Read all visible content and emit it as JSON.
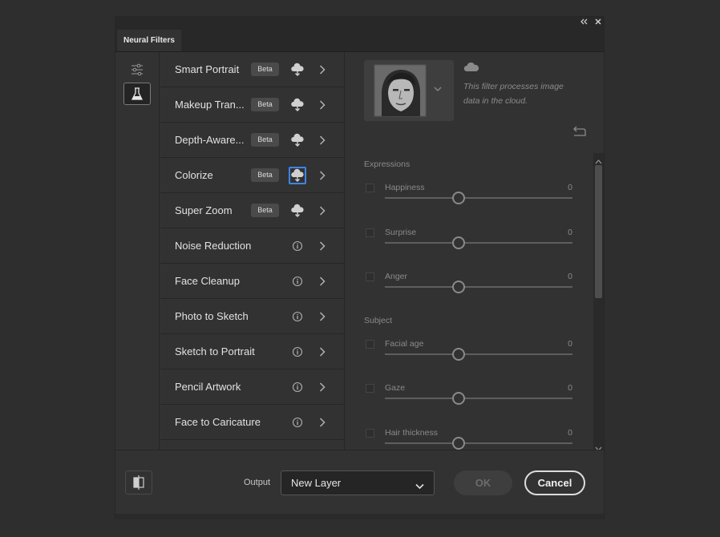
{
  "panel": {
    "tab_label": "Neural Filters",
    "collapse_icon": "double-chevron-left-icon",
    "close_icon": "close-icon"
  },
  "left_rail": {
    "items": [
      {
        "icon": "sliders-icon",
        "active": false
      },
      {
        "icon": "beaker-icon",
        "active": true
      }
    ]
  },
  "filters": [
    {
      "label": "Smart Portrait",
      "badge": "Beta",
      "icon": "cloud-download-icon"
    },
    {
      "label": "Makeup Tran...",
      "badge": "Beta",
      "icon": "cloud-download-icon"
    },
    {
      "label": "Depth-Aware...",
      "badge": "Beta",
      "icon": "cloud-download-icon"
    },
    {
      "label": "Colorize",
      "badge": "Beta",
      "icon": "cloud-download-icon",
      "focused": true
    },
    {
      "label": "Super Zoom",
      "badge": "Beta",
      "icon": "cloud-download-icon"
    },
    {
      "label": "Noise Reduction",
      "badge": "",
      "icon": "info-icon"
    },
    {
      "label": "Face Cleanup",
      "badge": "",
      "icon": "info-icon"
    },
    {
      "label": "Photo to Sketch",
      "badge": "",
      "icon": "info-icon"
    },
    {
      "label": "Sketch to Portrait",
      "badge": "",
      "icon": "info-icon"
    },
    {
      "label": "Pencil Artwork",
      "badge": "",
      "icon": "info-icon"
    },
    {
      "label": "Face to Caricature",
      "badge": "",
      "icon": "info-icon"
    }
  ],
  "detail": {
    "description": "This filter processes image data in the cloud.",
    "cloud_icon": "cloud-icon",
    "reset_icon": "reset-icon",
    "sections": [
      {
        "title": "Expressions",
        "controls": [
          {
            "label": "Happiness",
            "value": "0"
          },
          {
            "label": "Surprise",
            "value": "0"
          },
          {
            "label": "Anger",
            "value": "0"
          }
        ]
      },
      {
        "title": "Subject",
        "controls": [
          {
            "label": "Facial age",
            "value": "0"
          },
          {
            "label": "Gaze",
            "value": "0"
          },
          {
            "label": "Hair thickness",
            "value": "0"
          }
        ]
      }
    ]
  },
  "footer": {
    "output_label": "Output",
    "output_value": "New Layer",
    "ok_label": "OK",
    "cancel_label": "Cancel"
  },
  "colors": {
    "accent": "#3b86e8",
    "panel_bg": "#323232",
    "page_bg": "#2e2e2e"
  }
}
